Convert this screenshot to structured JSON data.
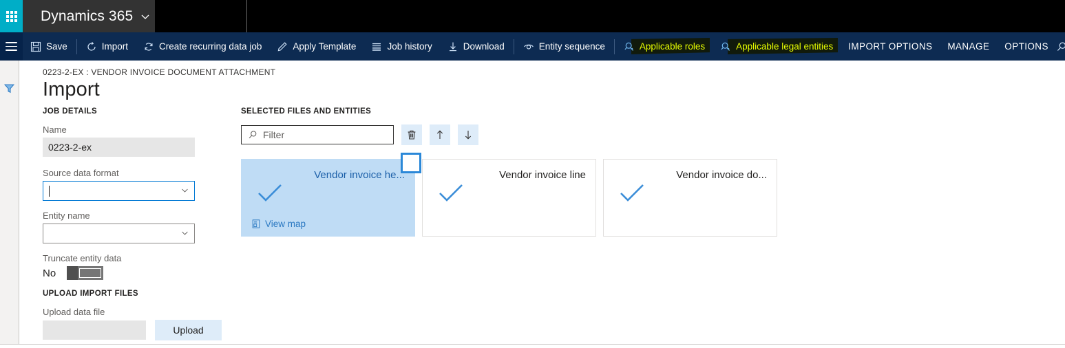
{
  "topbar": {
    "waffle_label": "app-launcher",
    "brand": "Dynamics 365",
    "brand_chevron": "⌄"
  },
  "commandbar": {
    "menu_label": "navigation-menu",
    "items": [
      {
        "label": "Save",
        "icon": "save-icon",
        "style": "normal"
      },
      {
        "label": "Import",
        "icon": "refresh-icon",
        "style": "normal"
      },
      {
        "label": "Create recurring data job",
        "icon": "sync-icon",
        "style": "normal"
      },
      {
        "label": "Apply Template",
        "icon": "pencil-icon",
        "style": "normal"
      },
      {
        "label": "Job history",
        "icon": "list-icon",
        "style": "normal"
      },
      {
        "label": "Download",
        "icon": "download-icon",
        "style": "normal"
      },
      {
        "label": "Entity sequence",
        "icon": "eye-icon",
        "style": "normal"
      },
      {
        "label": "Applicable roles",
        "icon": "magnifier-key-icon",
        "style": "highlighted"
      },
      {
        "label": "Applicable legal entities",
        "icon": "magnifier-key-icon",
        "style": "highlighted"
      },
      {
        "label": "IMPORT OPTIONS",
        "icon": "",
        "style": "caps"
      },
      {
        "label": "MANAGE",
        "icon": "",
        "style": "caps"
      },
      {
        "label": "OPTIONS",
        "icon": "",
        "style": "caps"
      }
    ],
    "search_icon": "search-icon",
    "highlight_text_color": "#e8ff00",
    "highlight_bg_color": "#111a0b"
  },
  "rail": {
    "filter_icon": "filter-funnel-icon"
  },
  "page": {
    "breadcrumb": "0223-2-EX : VENDOR INVOICE DOCUMENT ATTACHMENT",
    "title": "Import"
  },
  "job_details": {
    "section_title": "JOB DETAILS",
    "name_label": "Name",
    "name_value": "0223-2-ex",
    "source_format_label": "Source data format",
    "source_format_value": "",
    "entity_name_label": "Entity name",
    "entity_name_value": "",
    "truncate_label": "Truncate entity data",
    "truncate_value": "No"
  },
  "upload": {
    "section_title": "UPLOAD IMPORT FILES",
    "file_label": "Upload data file",
    "file_value": "",
    "button_label": "Upload"
  },
  "selected_files": {
    "section_title": "SELECTED FILES AND ENTITIES",
    "filter_placeholder": "Filter",
    "filter_value": "",
    "filter_icon": "search-icon",
    "actions": [
      {
        "name": "delete",
        "icon": "trash-icon"
      },
      {
        "name": "move-up",
        "icon": "arrow-up-icon"
      },
      {
        "name": "move-down",
        "icon": "arrow-down-icon"
      }
    ],
    "cards": [
      {
        "title": "Vendor invoice he...",
        "selected": true,
        "checked": false,
        "view_map_label": "View map",
        "view_map_icon": "map-document-icon"
      },
      {
        "title": "Vendor invoice line",
        "selected": false,
        "checked": false,
        "view_map_label": "",
        "view_map_icon": ""
      },
      {
        "title": "Vendor invoice do...",
        "selected": false,
        "checked": false,
        "view_map_label": "",
        "view_map_icon": ""
      }
    ]
  },
  "colors": {
    "accent_teal": "#00aec7",
    "command_navy": "#0d2b52",
    "selected_card": "#bfdcf5",
    "link_blue": "#2b79c2",
    "button_blue": "#deecf9"
  }
}
